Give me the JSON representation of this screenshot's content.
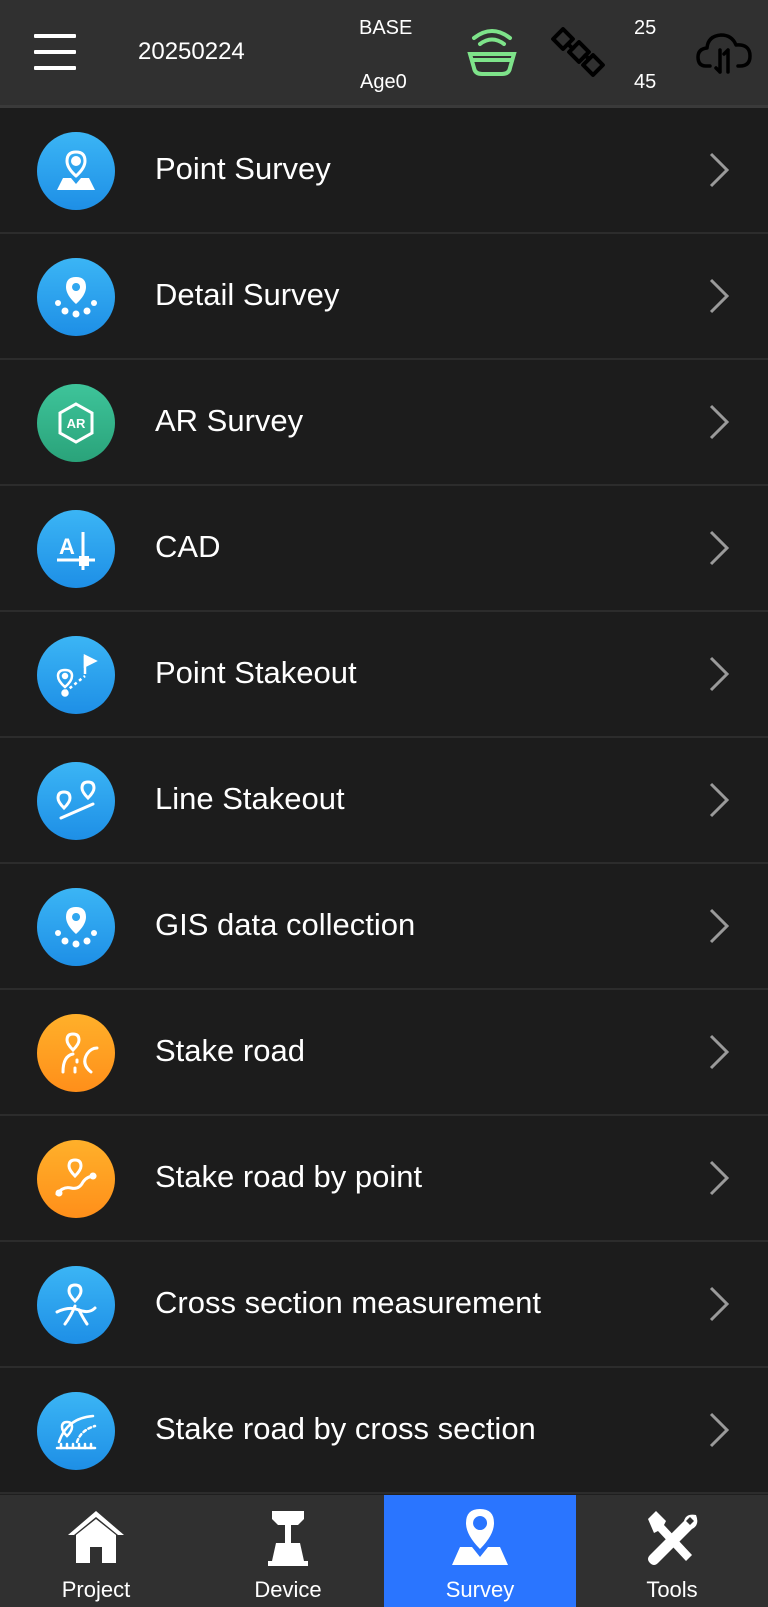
{
  "header": {
    "project_name": "20250224",
    "base_label": "BASE",
    "age_label": "Age0",
    "satellites_top": "25",
    "satellites_bottom": "45",
    "receiver_icon_color": "#7ee38a"
  },
  "menu": {
    "items": [
      {
        "label": "Point Survey",
        "icon": "point-survey-icon",
        "color": "blue"
      },
      {
        "label": "Detail Survey",
        "icon": "detail-survey-icon",
        "color": "blue"
      },
      {
        "label": "AR Survey",
        "icon": "ar-survey-icon",
        "color": "green"
      },
      {
        "label": "CAD",
        "icon": "cad-icon",
        "color": "blue"
      },
      {
        "label": "Point Stakeout",
        "icon": "point-stakeout-icon",
        "color": "blue"
      },
      {
        "label": "Line Stakeout",
        "icon": "line-stakeout-icon",
        "color": "blue"
      },
      {
        "label": "GIS data collection",
        "icon": "gis-collection-icon",
        "color": "blue"
      },
      {
        "label": "Stake road",
        "icon": "stake-road-icon",
        "color": "orange"
      },
      {
        "label": "Stake road by point",
        "icon": "stake-road-by-point-icon",
        "color": "orange"
      },
      {
        "label": "Cross section measurement",
        "icon": "cross-section-icon",
        "color": "blue"
      },
      {
        "label": "Stake road by cross section",
        "icon": "stake-road-cross-section-icon",
        "color": "blue"
      }
    ]
  },
  "nav": {
    "tabs": [
      {
        "label": "Project",
        "icon": "home-icon"
      },
      {
        "label": "Device",
        "icon": "device-icon"
      },
      {
        "label": "Survey",
        "icon": "survey-icon",
        "active": true
      },
      {
        "label": "Tools",
        "icon": "tools-icon"
      }
    ],
    "active_color": "#2a75ff"
  }
}
